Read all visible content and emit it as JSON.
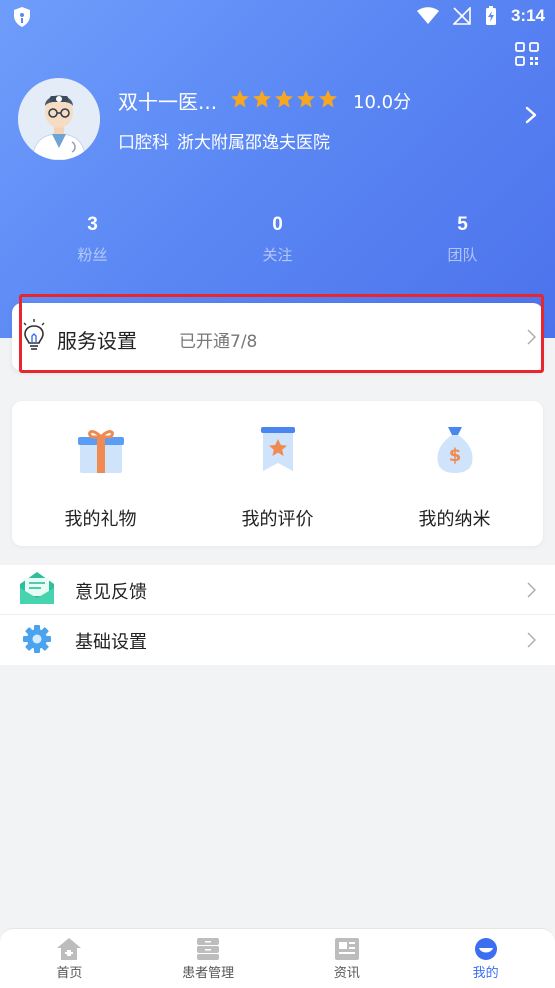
{
  "status_bar": {
    "time": "3:14"
  },
  "profile": {
    "name": "双十一医...",
    "rating_stars": 5,
    "score": "10.0分",
    "department": "口腔科",
    "hospital": "浙大附属邵逸夫医院"
  },
  "stats": [
    {
      "value": "3",
      "label": "粉丝"
    },
    {
      "value": "0",
      "label": "关注"
    },
    {
      "value": "5",
      "label": "团队"
    }
  ],
  "service": {
    "title": "服务设置",
    "status": "已开通7/8"
  },
  "features": [
    {
      "label": "我的礼物",
      "icon": "gift-icon"
    },
    {
      "label": "我的评价",
      "icon": "rating-badge-icon"
    },
    {
      "label": "我的纳米",
      "icon": "money-bag-icon"
    }
  ],
  "menu": [
    {
      "label": "意见反馈",
      "icon": "feedback-mail-icon"
    },
    {
      "label": "基础设置",
      "icon": "gear-icon"
    }
  ],
  "tabs": [
    {
      "label": "首页",
      "icon": "home-icon"
    },
    {
      "label": "患者管理",
      "icon": "patient-management-icon"
    },
    {
      "label": "资讯",
      "icon": "news-icon"
    },
    {
      "label": "我的",
      "icon": "profile-icon",
      "active": true
    }
  ],
  "colors": {
    "accent": "#3b6ef0",
    "highlight": "#e8262b",
    "star": "#f5a623"
  }
}
